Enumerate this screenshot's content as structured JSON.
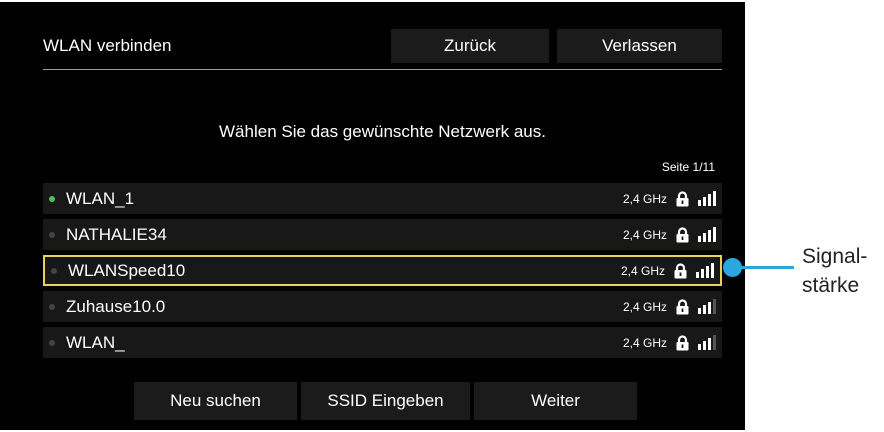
{
  "header": {
    "title": "WLAN verbinden",
    "back_label": "Zurück",
    "exit_label": "Verlassen"
  },
  "prompt": "Wählen Sie das gewünschte Netzwerk aus.",
  "page_indicator": "Seite 1/11",
  "networks": [
    {
      "ssid": "WLAN_1",
      "band": "2,4 GHz",
      "connected": true,
      "selected": false,
      "signal_bars": 4
    },
    {
      "ssid": "NATHALIE34",
      "band": "2,4 GHz",
      "connected": false,
      "selected": false,
      "signal_bars": 4
    },
    {
      "ssid": "WLANSpeed10",
      "band": "2,4 GHz",
      "connected": false,
      "selected": true,
      "signal_bars": 4
    },
    {
      "ssid": "Zuhause10.0",
      "band": "2,4 GHz",
      "connected": false,
      "selected": false,
      "signal_bars": 3
    },
    {
      "ssid": "WLAN_",
      "band": "2,4 GHz",
      "connected": false,
      "selected": false,
      "signal_bars": 3
    }
  ],
  "footer": {
    "rescan_label": "Neu suchen",
    "ssid_label": "SSID Eingeben",
    "next_label": "Weiter"
  },
  "callout": {
    "line1": "Signal-",
    "line2": "stärke"
  },
  "icons": {
    "lock": "lock-icon",
    "signal": "signal-strength-icon"
  },
  "colors": {
    "screen_background": "#000000",
    "row_background": "#181818",
    "selected_border": "#e6d35c",
    "connected_dot": "#49c25a",
    "callout": "#2aa8dd"
  }
}
